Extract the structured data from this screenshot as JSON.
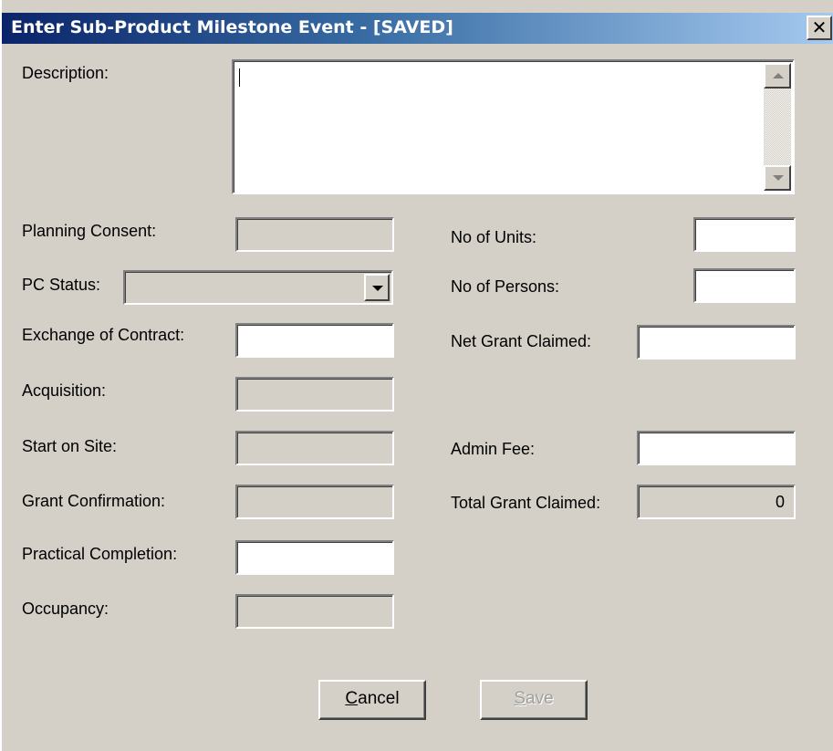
{
  "window": {
    "title": "Enter Sub-Product Milestone Event - [SAVED]",
    "close_glyph": "✕"
  },
  "form": {
    "description_label": "Description:",
    "description_value": "",
    "planning_consent_label": "Planning Consent:",
    "pc_status_label": "PC Status:",
    "pc_status_value": "",
    "exchange_of_contract_label": "Exchange of Contract:",
    "acquisition_label": "Acquisition:",
    "start_on_site_label": "Start on Site:",
    "grant_confirmation_label": "Grant Confirmation:",
    "practical_completion_label": "Practical Completion:",
    "occupancy_label": "Occupancy:",
    "no_of_units_label": "No of Units:",
    "no_of_persons_label": "No of Persons:",
    "net_grant_claimed_label": "Net Grant Claimed:",
    "admin_fee_label": "Admin Fee:",
    "total_grant_claimed_label": "Total Grant Claimed:",
    "total_grant_claimed_value": "0"
  },
  "buttons": {
    "cancel_mnemonic": "C",
    "cancel_rest": "ancel",
    "save_mnemonic": "S",
    "save_rest": "ave"
  },
  "colors": {
    "titlebar_start": "#0a246a",
    "titlebar_end": "#a6caf0",
    "dialog_bg": "#d4d0c8"
  }
}
